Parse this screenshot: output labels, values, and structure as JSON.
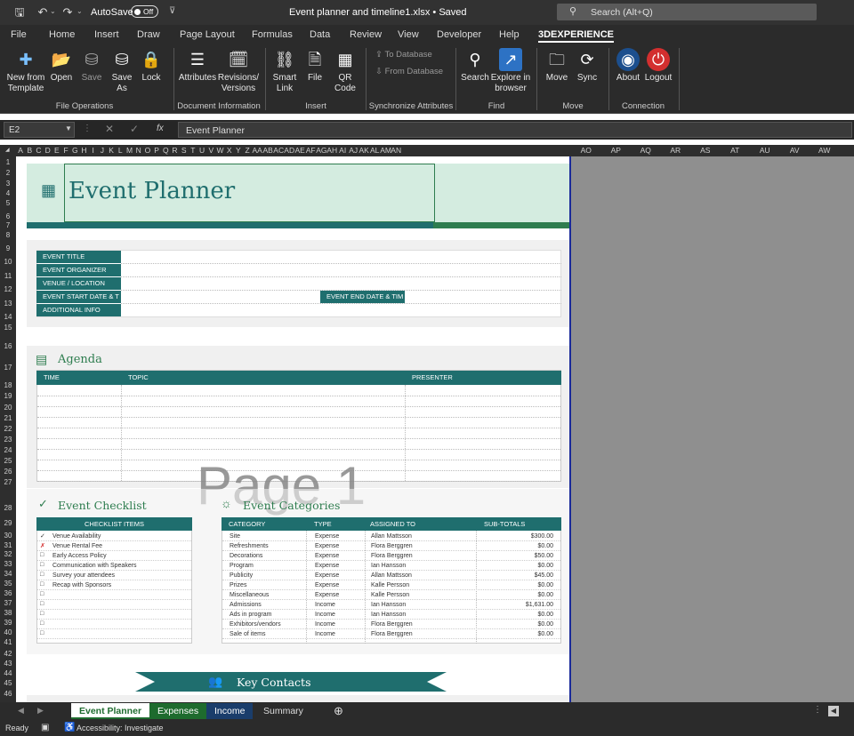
{
  "titlebar": {
    "autosave_label": "AutoSave",
    "autosave_state": "Off",
    "doc_title": "Event planner and timeline1.xlsx • Saved",
    "search_placeholder": "Search (Alt+Q)"
  },
  "ribbon_tabs": [
    "File",
    "Home",
    "Insert",
    "Draw",
    "Page Layout",
    "Formulas",
    "Data",
    "Review",
    "View",
    "Developer",
    "Help",
    "3DEXPERIENCE"
  ],
  "ribbon": {
    "new_from_template": "New from Template",
    "open": "Open",
    "save": "Save",
    "save_as": "Save As",
    "lock": "Lock",
    "attributes": "Attributes",
    "revisions": "Revisions/ Versions",
    "smart_link": "Smart Link",
    "file": "File",
    "qr_code": "QR Code",
    "to_database": "To Database",
    "from_database": "From Database",
    "search": "Search",
    "explore": "Explore in browser",
    "move": "Move",
    "sync": "Sync",
    "about": "About",
    "logout": "Logout",
    "groups": {
      "file_ops": "File Operations",
      "doc_info": "Document Information",
      "insert": "Insert",
      "sync_attr": "Synchronize Attributes",
      "find": "Find",
      "move": "Move",
      "connection": "Connection"
    }
  },
  "formula": {
    "name_box": "E2",
    "fx": "fx",
    "content": "Event Planner"
  },
  "columns": [
    "A",
    "B",
    "C",
    "D",
    "E",
    "F",
    "G",
    "H",
    "I",
    "J",
    "K",
    "L",
    "M",
    "N",
    "O",
    "P",
    "Q",
    "R",
    "S",
    "T",
    "U",
    "V",
    "W",
    "X",
    "Y",
    "Z",
    "AA",
    "AB",
    "AC",
    "AD",
    "AE",
    "AF",
    "AG",
    "AH",
    "AI",
    "AJ",
    "AK",
    "AL",
    "AM",
    "AN",
    "AO",
    "AP",
    "AQ",
    "AR",
    "AS",
    "AT",
    "AU",
    "AV",
    "AW"
  ],
  "rows": [
    "1",
    "2",
    "3",
    "4",
    "5",
    "6",
    "7",
    "8",
    "9",
    "10",
    "11",
    "12",
    "13",
    "14",
    "15",
    "16",
    "17",
    "18",
    "19",
    "20",
    "21",
    "22",
    "23",
    "24",
    "25",
    "26",
    "27",
    "28",
    "29",
    "30",
    "31",
    "32",
    "33",
    "34",
    "35",
    "36",
    "37",
    "38",
    "39",
    "40",
    "41",
    "42",
    "43",
    "44",
    "45",
    "46",
    "47"
  ],
  "planner": {
    "title": "Event Planner",
    "fields": {
      "event_title": "EVENT TITLE",
      "event_organizer": "EVENT ORGANIZER",
      "venue": "VENUE / LOCATION",
      "start": "EVENT START DATE & T",
      "end": "EVENT END DATE & TIM",
      "additional": "ADDITIONAL INFO"
    },
    "agenda": {
      "title": "Agenda",
      "headers": [
        "TIME",
        "TOPIC",
        "PRESENTER"
      ]
    },
    "watermark": "Page 1",
    "checklist": {
      "title": "Event Checklist",
      "header": "CHECKLIST ITEMS",
      "items": [
        {
          "mark": "✓",
          "text": "Venue Availability"
        },
        {
          "mark": "✗",
          "text": "Venue Rental Fee"
        },
        {
          "mark": "□",
          "text": "Early Access Policy"
        },
        {
          "mark": "□",
          "text": "Communication with Speakers"
        },
        {
          "mark": "□",
          "text": "Survey your attendees"
        },
        {
          "mark": "□",
          "text": "Recap with Sponsors"
        },
        {
          "mark": "□",
          "text": ""
        },
        {
          "mark": "□",
          "text": ""
        },
        {
          "mark": "□",
          "text": ""
        },
        {
          "mark": "□",
          "text": ""
        },
        {
          "mark": "□",
          "text": ""
        }
      ]
    },
    "categories": {
      "title": "Event Categories",
      "headers": [
        "CATEGORY",
        "TYPE",
        "ASSIGNED TO",
        "SUB-TOTALS"
      ],
      "rows": [
        [
          "Site",
          "Expense",
          "Allan Mattsson",
          "$300.00"
        ],
        [
          "Refreshments",
          "Expense",
          "Flora Berggren",
          "$0.00"
        ],
        [
          "Decorations",
          "Expense",
          "Flora Berggren",
          "$50.00"
        ],
        [
          "Program",
          "Expense",
          "Ian Hansson",
          "$0.00"
        ],
        [
          "Publicity",
          "Expense",
          "Allan Mattsson",
          "$45.00"
        ],
        [
          "Prizes",
          "Expense",
          "Kalle Persson",
          "$0.00"
        ],
        [
          "Miscellaneous",
          "Expense",
          "Kalle Persson",
          "$0.00"
        ],
        [
          "Admissions",
          "Income",
          "Ian Hansson",
          "$1,631.00"
        ],
        [
          "Ads in program",
          "Income",
          "Ian Hansson",
          "$0.00"
        ],
        [
          "Exhibitors/vendors",
          "Income",
          "Flora Berggren",
          "$0.00"
        ],
        [
          "Sale of items",
          "Income",
          "Flora Berggren",
          "$0.00"
        ]
      ]
    },
    "contacts": {
      "title": "Key Contacts"
    }
  },
  "sheet_tabs": [
    "Event Planner",
    "Expenses",
    "Income",
    "Summary"
  ],
  "status": {
    "ready": "Ready",
    "accessibility": "Accessibility: Investigate"
  },
  "colors": {
    "teal": "#1f6e6e",
    "mint": "#d4ece0",
    "green": "#2e7d4f"
  }
}
